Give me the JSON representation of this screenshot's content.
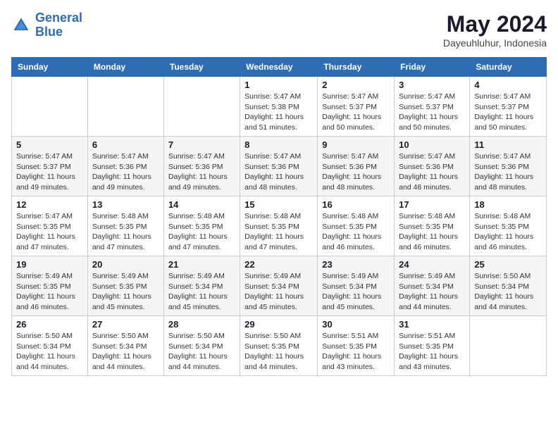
{
  "logo": {
    "line1": "General",
    "line2": "Blue"
  },
  "title": "May 2024",
  "location": "Dayeuhluhur, Indonesia",
  "days_of_week": [
    "Sunday",
    "Monday",
    "Tuesday",
    "Wednesday",
    "Thursday",
    "Friday",
    "Saturday"
  ],
  "weeks": [
    [
      {
        "day": "",
        "info": ""
      },
      {
        "day": "",
        "info": ""
      },
      {
        "day": "",
        "info": ""
      },
      {
        "day": "1",
        "info": "Sunrise: 5:47 AM\nSunset: 5:38 PM\nDaylight: 11 hours\nand 51 minutes."
      },
      {
        "day": "2",
        "info": "Sunrise: 5:47 AM\nSunset: 5:37 PM\nDaylight: 11 hours\nand 50 minutes."
      },
      {
        "day": "3",
        "info": "Sunrise: 5:47 AM\nSunset: 5:37 PM\nDaylight: 11 hours\nand 50 minutes."
      },
      {
        "day": "4",
        "info": "Sunrise: 5:47 AM\nSunset: 5:37 PM\nDaylight: 11 hours\nand 50 minutes."
      }
    ],
    [
      {
        "day": "5",
        "info": "Sunrise: 5:47 AM\nSunset: 5:37 PM\nDaylight: 11 hours\nand 49 minutes."
      },
      {
        "day": "6",
        "info": "Sunrise: 5:47 AM\nSunset: 5:36 PM\nDaylight: 11 hours\nand 49 minutes."
      },
      {
        "day": "7",
        "info": "Sunrise: 5:47 AM\nSunset: 5:36 PM\nDaylight: 11 hours\nand 49 minutes."
      },
      {
        "day": "8",
        "info": "Sunrise: 5:47 AM\nSunset: 5:36 PM\nDaylight: 11 hours\nand 48 minutes."
      },
      {
        "day": "9",
        "info": "Sunrise: 5:47 AM\nSunset: 5:36 PM\nDaylight: 11 hours\nand 48 minutes."
      },
      {
        "day": "10",
        "info": "Sunrise: 5:47 AM\nSunset: 5:36 PM\nDaylight: 11 hours\nand 48 minutes."
      },
      {
        "day": "11",
        "info": "Sunrise: 5:47 AM\nSunset: 5:36 PM\nDaylight: 11 hours\nand 48 minutes."
      }
    ],
    [
      {
        "day": "12",
        "info": "Sunrise: 5:47 AM\nSunset: 5:35 PM\nDaylight: 11 hours\nand 47 minutes."
      },
      {
        "day": "13",
        "info": "Sunrise: 5:48 AM\nSunset: 5:35 PM\nDaylight: 11 hours\nand 47 minutes."
      },
      {
        "day": "14",
        "info": "Sunrise: 5:48 AM\nSunset: 5:35 PM\nDaylight: 11 hours\nand 47 minutes."
      },
      {
        "day": "15",
        "info": "Sunrise: 5:48 AM\nSunset: 5:35 PM\nDaylight: 11 hours\nand 47 minutes."
      },
      {
        "day": "16",
        "info": "Sunrise: 5:48 AM\nSunset: 5:35 PM\nDaylight: 11 hours\nand 46 minutes."
      },
      {
        "day": "17",
        "info": "Sunrise: 5:48 AM\nSunset: 5:35 PM\nDaylight: 11 hours\nand 46 minutes."
      },
      {
        "day": "18",
        "info": "Sunrise: 5:48 AM\nSunset: 5:35 PM\nDaylight: 11 hours\nand 46 minutes."
      }
    ],
    [
      {
        "day": "19",
        "info": "Sunrise: 5:49 AM\nSunset: 5:35 PM\nDaylight: 11 hours\nand 46 minutes."
      },
      {
        "day": "20",
        "info": "Sunrise: 5:49 AM\nSunset: 5:35 PM\nDaylight: 11 hours\nand 45 minutes."
      },
      {
        "day": "21",
        "info": "Sunrise: 5:49 AM\nSunset: 5:34 PM\nDaylight: 11 hours\nand 45 minutes."
      },
      {
        "day": "22",
        "info": "Sunrise: 5:49 AM\nSunset: 5:34 PM\nDaylight: 11 hours\nand 45 minutes."
      },
      {
        "day": "23",
        "info": "Sunrise: 5:49 AM\nSunset: 5:34 PM\nDaylight: 11 hours\nand 45 minutes."
      },
      {
        "day": "24",
        "info": "Sunrise: 5:49 AM\nSunset: 5:34 PM\nDaylight: 11 hours\nand 44 minutes."
      },
      {
        "day": "25",
        "info": "Sunrise: 5:50 AM\nSunset: 5:34 PM\nDaylight: 11 hours\nand 44 minutes."
      }
    ],
    [
      {
        "day": "26",
        "info": "Sunrise: 5:50 AM\nSunset: 5:34 PM\nDaylight: 11 hours\nand 44 minutes."
      },
      {
        "day": "27",
        "info": "Sunrise: 5:50 AM\nSunset: 5:34 PM\nDaylight: 11 hours\nand 44 minutes."
      },
      {
        "day": "28",
        "info": "Sunrise: 5:50 AM\nSunset: 5:34 PM\nDaylight: 11 hours\nand 44 minutes."
      },
      {
        "day": "29",
        "info": "Sunrise: 5:50 AM\nSunset: 5:35 PM\nDaylight: 11 hours\nand 44 minutes."
      },
      {
        "day": "30",
        "info": "Sunrise: 5:51 AM\nSunset: 5:35 PM\nDaylight: 11 hours\nand 43 minutes."
      },
      {
        "day": "31",
        "info": "Sunrise: 5:51 AM\nSunset: 5:35 PM\nDaylight: 11 hours\nand 43 minutes."
      },
      {
        "day": "",
        "info": ""
      }
    ]
  ]
}
